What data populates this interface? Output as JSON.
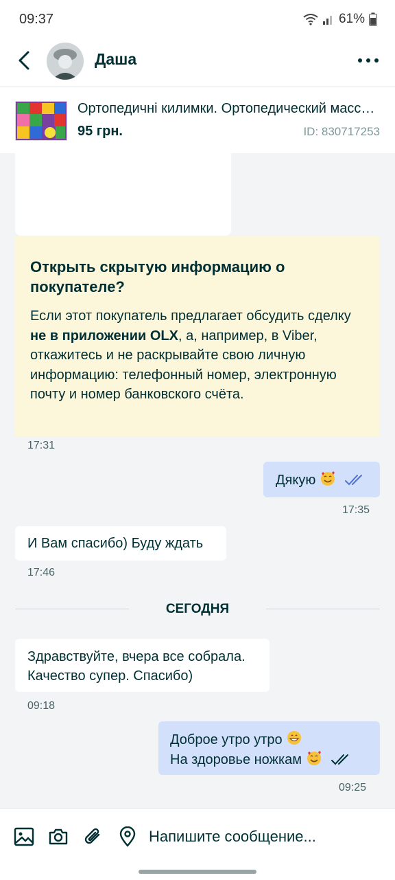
{
  "status_bar": {
    "time": "09:37",
    "battery": "61%"
  },
  "header": {
    "contact_name": "Даша"
  },
  "listing": {
    "title": "Ортопедичні килимки. Ортопедический массажный коврик",
    "price": "95 грн.",
    "id": "ID: 830717253"
  },
  "warning": {
    "title": "Открыть скрытую информацию о покупателе?",
    "body_1": "Если этот покупатель предлагает обсудить сделку ",
    "body_bold": "не в приложении OLX",
    "body_2": ", а, например, в Viber, откажитесь и не раскрывайте свою личную информацию: телефонный номер, электронную почту и номер банковского счёта.",
    "time": "17:31"
  },
  "messages": [
    {
      "direction": "out",
      "text": "Дякую",
      "time": "17:35"
    },
    {
      "direction": "in",
      "text": "И Вам спасибо) Буду ждать",
      "time": "17:46"
    },
    {
      "direction": "in",
      "line1": "Здравствуйте, вчера все собрала.",
      "line2": "Качество супер. Спасибо)",
      "time": "09:18"
    },
    {
      "direction": "out",
      "line1": "Доброе утро утро",
      "line2": "На здоровье  ножкам",
      "time": "09:25"
    }
  ],
  "date_separator": "СЕГОДНЯ",
  "input": {
    "placeholder": "Напишите сообщение..."
  },
  "colors": {
    "outgoing_bubble": "#d3e0fc",
    "warning_bg": "#fcf6da",
    "text": "#002f34",
    "background": "#f2f4f5"
  }
}
